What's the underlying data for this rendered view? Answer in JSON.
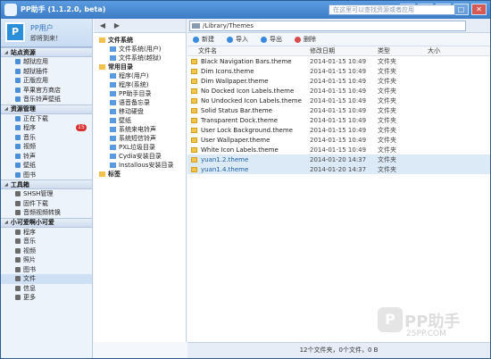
{
  "app": {
    "title": "PP助手 (1.1.2.0, beta)"
  },
  "profile": {
    "name": "PP用户",
    "greeting": "即将到来！",
    "avatar_text": "P"
  },
  "sidebar": {
    "sections": [
      {
        "title": "站点资源",
        "items": [
          {
            "label": "越狱应用",
            "icon_color": "#4c8ed8"
          },
          {
            "label": "越狱插件",
            "icon_color": "#4c8ed8"
          },
          {
            "label": "正版应用",
            "icon_color": "#4c8ed8"
          },
          {
            "label": "苹果官方商店",
            "icon_color": "#4c8ed8"
          },
          {
            "label": "音乐铃声壁纸",
            "icon_color": "#4c8ed8"
          }
        ]
      },
      {
        "title": "资源管理",
        "items": [
          {
            "label": "正在下载",
            "icon_color": "#4c8ed8"
          },
          {
            "label": "程序",
            "icon_color": "#4c8ed8",
            "badge": "15"
          },
          {
            "label": "音乐",
            "icon_color": "#4c8ed8"
          },
          {
            "label": "视频",
            "icon_color": "#4c8ed8"
          },
          {
            "label": "铃声",
            "icon_color": "#4c8ed8"
          },
          {
            "label": "壁纸",
            "icon_color": "#4c8ed8"
          },
          {
            "label": "图书",
            "icon_color": "#4c8ed8"
          }
        ]
      },
      {
        "title": "工具箱",
        "items": [
          {
            "label": "SHSH管理",
            "icon_color": "#6b6b6b"
          },
          {
            "label": "固件下载",
            "icon_color": "#6b6b6b"
          },
          {
            "label": "音频视频转换",
            "icon_color": "#6b6b6b"
          }
        ]
      },
      {
        "title": "小可爱啊小可爱",
        "items": [
          {
            "label": "程序",
            "icon_color": "#6b6b6b"
          },
          {
            "label": "音乐",
            "icon_color": "#6b6b6b"
          },
          {
            "label": "视频",
            "icon_color": "#6b6b6b"
          },
          {
            "label": "照片",
            "icon_color": "#6b6b6b"
          },
          {
            "label": "图书",
            "icon_color": "#6b6b6b"
          },
          {
            "label": "文件",
            "icon_color": "#6b6b6b",
            "selected": true
          },
          {
            "label": "信息",
            "icon_color": "#6b6b6b"
          },
          {
            "label": "更多",
            "icon_color": "#6b6b6b"
          }
        ]
      }
    ]
  },
  "tree": {
    "nodes": [
      {
        "label": "文件系统",
        "level": 0,
        "head": true
      },
      {
        "label": "文件系统(用户)",
        "level": 1
      },
      {
        "label": "文件系统(越狱)",
        "level": 1
      },
      {
        "label": "常用目录",
        "level": 0,
        "head": true
      },
      {
        "label": "程序(用户)",
        "level": 1
      },
      {
        "label": "程序(系统)",
        "level": 1
      },
      {
        "label": "PP助手目录",
        "level": 1
      },
      {
        "label": "语音备忘录",
        "level": 1
      },
      {
        "label": "移动硬盘",
        "level": 1
      },
      {
        "label": "壁纸",
        "level": 1
      },
      {
        "label": "系统来电铃声",
        "level": 1
      },
      {
        "label": "系统短信铃声",
        "level": 1
      },
      {
        "label": "PXL垃圾目录",
        "level": 1
      },
      {
        "label": "Cydia安装目录",
        "level": 1
      },
      {
        "label": "Installous安装目录",
        "level": 1
      },
      {
        "label": "标签",
        "level": 0,
        "head": true
      }
    ]
  },
  "path": {
    "value": "/Library/Themes"
  },
  "search": {
    "placeholder": "在这里可以查找资源或者应用"
  },
  "toolbar": {
    "new": "新建",
    "import": "导入",
    "export": "导出",
    "delete": "删除"
  },
  "table": {
    "headers": {
      "name": "文件名",
      "date": "修改日期",
      "type": "类型",
      "size": "大小"
    },
    "rows": [
      {
        "name": "Black Navigation Bars.theme",
        "date": "2014-01-15 10:49",
        "type": "文件夹",
        "size": ""
      },
      {
        "name": "Dim Icons.theme",
        "date": "2014-01-15 10:49",
        "type": "文件夹",
        "size": ""
      },
      {
        "name": "Dim Wallpaper.theme",
        "date": "2014-01-15 10:49",
        "type": "文件夹",
        "size": ""
      },
      {
        "name": "No Docked Icon Labels.theme",
        "date": "2014-01-15 10:49",
        "type": "文件夹",
        "size": ""
      },
      {
        "name": "No Undocked Icon Labels.theme",
        "date": "2014-01-15 10:49",
        "type": "文件夹",
        "size": ""
      },
      {
        "name": "Solid Status Bar.theme",
        "date": "2014-01-15 10:49",
        "type": "文件夹",
        "size": ""
      },
      {
        "name": "Transparent Dock.theme",
        "date": "2014-01-15 10:49",
        "type": "文件夹",
        "size": ""
      },
      {
        "name": "User Lock Background.theme",
        "date": "2014-01-15 10:49",
        "type": "文件夹",
        "size": ""
      },
      {
        "name": "User Wallpaper.theme",
        "date": "2014-01-15 10:49",
        "type": "文件夹",
        "size": ""
      },
      {
        "name": "White Icon Labels.theme",
        "date": "2014-01-15 10:49",
        "type": "文件夹",
        "size": ""
      },
      {
        "name": "yuan1.2.theme",
        "date": "2014-01-20 14:37",
        "type": "文件夹",
        "size": "",
        "selected": true
      },
      {
        "name": "yuan1.4.theme",
        "date": "2014-01-20 14:37",
        "type": "文件夹",
        "size": "",
        "selected": true
      }
    ]
  },
  "status": {
    "text": "12个文件夹，0个文件，0 B"
  },
  "watermark": {
    "logo": "P",
    "text": "PP助手",
    "url": "25PP.COM"
  }
}
